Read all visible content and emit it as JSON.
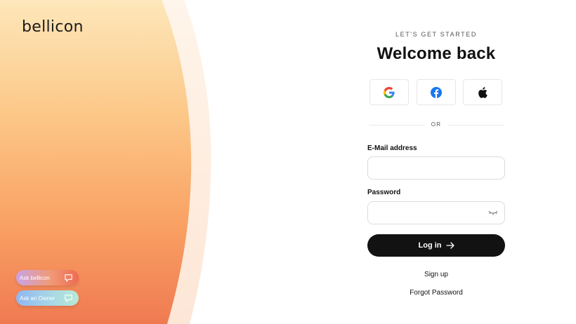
{
  "brand": {
    "logo_text": "bellicon"
  },
  "assist": {
    "ask_bellicon": "Ask bellicon",
    "ask_owner": "Ask an Owner"
  },
  "login": {
    "eyebrow": "LET'S GET STARTED",
    "title": "Welcome back",
    "social": [
      {
        "provider": "Google",
        "icon": "google-icon"
      },
      {
        "provider": "Facebook",
        "icon": "facebook-icon"
      },
      {
        "provider": "Apple",
        "icon": "apple-icon"
      }
    ],
    "divider_text": "OR",
    "email_label": "E-Mail address",
    "email_value": "",
    "password_label": "Password",
    "password_value": "",
    "login_button": "Log in",
    "signup_link": "Sign up",
    "forgot_link": "Forgot Password"
  },
  "colors": {
    "primary_button": "#121212",
    "gradient_top": "#fde6b8",
    "gradient_mid": "#fbb574",
    "gradient_bottom": "#f07c55"
  }
}
